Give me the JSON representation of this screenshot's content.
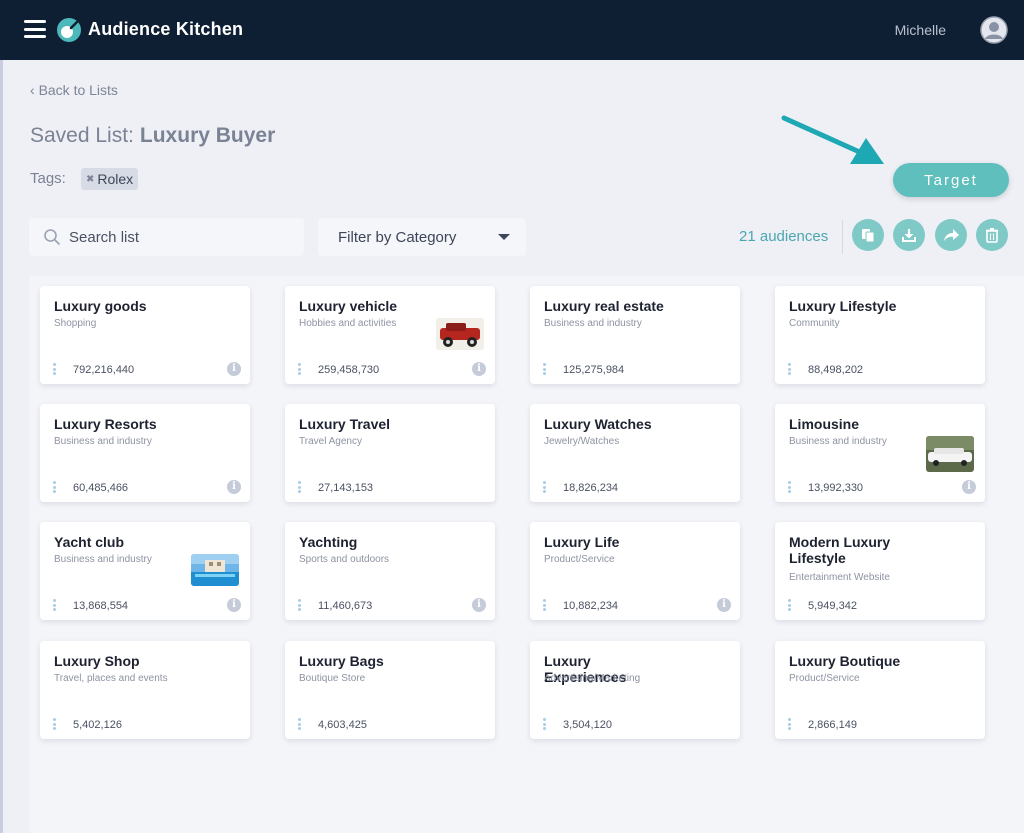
{
  "app": {
    "title": "Audience Kitchen",
    "user": "Michelle"
  },
  "nav": {
    "back_label": "Back to Lists"
  },
  "list": {
    "label": "Saved List:",
    "name": "Luxury Buyer",
    "tags_label": "Tags:",
    "tags": [
      "Rolex"
    ]
  },
  "toolbar": {
    "search_placeholder": "Search list",
    "filter_label": "Filter by Category",
    "count_label": "21 audiences",
    "target_label": "Target",
    "actions": [
      "copy-icon",
      "download-icon",
      "share-icon",
      "trash-icon"
    ]
  },
  "colors": {
    "topbar": "#0f1f33",
    "accent": "#5fbfbd",
    "accent_text": "#4aa7b0"
  },
  "audiences": [
    {
      "name": "Luxury goods",
      "category": "Shopping",
      "count": "792,216,440",
      "info": true,
      "thumb": null
    },
    {
      "name": "Luxury vehicle",
      "category": "Hobbies and activities",
      "count": "259,458,730",
      "info": true,
      "thumb": "car"
    },
    {
      "name": "Luxury real estate",
      "category": "Business and industry",
      "count": "125,275,984",
      "info": false,
      "thumb": null
    },
    {
      "name": "Luxury Lifestyle",
      "category": "Community",
      "count": "88,498,202",
      "info": false,
      "thumb": null
    },
    {
      "name": "Luxury Resorts",
      "category": "Business and industry",
      "count": "60,485,466",
      "info": true,
      "thumb": null
    },
    {
      "name": "Luxury Travel",
      "category": "Travel Agency",
      "count": "27,143,153",
      "info": false,
      "thumb": null
    },
    {
      "name": "Luxury Watches",
      "category": "Jewelry/Watches",
      "count": "18,826,234",
      "info": false,
      "thumb": null
    },
    {
      "name": "Limousine",
      "category": "Business and industry",
      "count": "13,992,330",
      "info": true,
      "thumb": "limo"
    },
    {
      "name": "Yacht club",
      "category": "Business and industry",
      "count": "13,868,554",
      "info": true,
      "thumb": "pool"
    },
    {
      "name": "Yachting",
      "category": "Sports and outdoors",
      "count": "11,460,673",
      "info": true,
      "thumb": null
    },
    {
      "name": "Luxury Life",
      "category": "Product/Service",
      "count": "10,882,234",
      "info": true,
      "thumb": null
    },
    {
      "name": "Modern Luxury Lifestyle",
      "category": "Entertainment Website",
      "count": "5,949,342",
      "info": false,
      "thumb": null
    },
    {
      "name": "Luxury Shop",
      "category": "Travel, places and events",
      "count": "5,402,126",
      "info": false,
      "thumb": null
    },
    {
      "name": "Luxury Bags",
      "category": "Boutique Store",
      "count": "4,603,425",
      "info": false,
      "thumb": null
    },
    {
      "name": "Luxury Experiences",
      "category": "Advertising/Marketing",
      "count": "3,504,120",
      "info": false,
      "thumb": null
    },
    {
      "name": "Luxury Boutique",
      "category": "Product/Service",
      "count": "2,866,149",
      "info": false,
      "thumb": null
    }
  ]
}
